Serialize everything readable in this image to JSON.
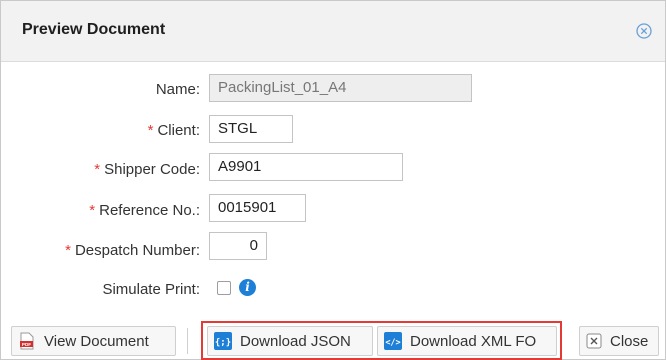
{
  "dialog": {
    "title": "Preview Document"
  },
  "form": {
    "name": {
      "label": "Name:",
      "value": "PackingList_01_A4",
      "required": false,
      "disabled": true
    },
    "client": {
      "label": "Client:",
      "value": "STGL",
      "required": true
    },
    "shipper_code": {
      "label": "Shipper Code:",
      "value": "A9901",
      "required": true
    },
    "reference_no": {
      "label": "Reference No.:",
      "value": "0015901",
      "required": true
    },
    "despatch_number": {
      "label": "Despatch Number:",
      "value": "0",
      "required": true
    },
    "simulate_print": {
      "label": "Simulate Print:",
      "checked": false
    },
    "required_marker": "*"
  },
  "buttons": {
    "view_document": "View Document",
    "download_json": "Download JSON",
    "download_xml_fo": "Download XML FO",
    "close": "Close"
  },
  "icons": {
    "close": "close-circle-icon",
    "view_document": "pdf-document-icon",
    "download_json": "json-braces-icon",
    "download_xml_fo": "xml-code-icon",
    "close_button": "x-box-icon",
    "info": "info-icon"
  },
  "colors": {
    "required": "#e53935",
    "highlight": "#e53935",
    "info": "#1e7fd6",
    "icon_blue": "#1e7fd6"
  }
}
